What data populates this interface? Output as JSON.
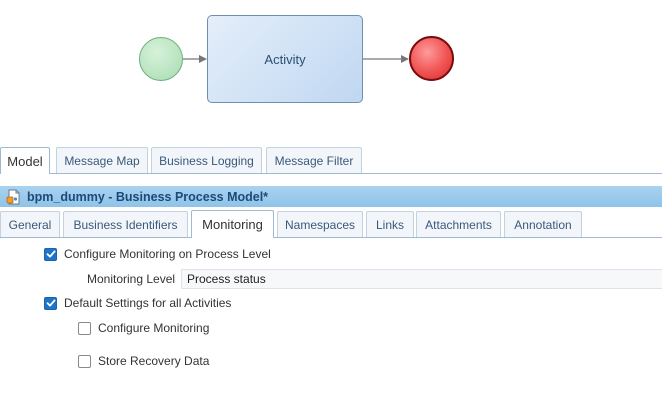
{
  "diagram": {
    "activity_label": "Activity"
  },
  "top_tabs": [
    "Model",
    "Message Map",
    "Business Logging",
    "Message Filter"
  ],
  "top_tabs_active": 0,
  "title_bar": {
    "icon": "process-model-document-icon",
    "title": "bpm_dummy - Business Process Model*",
    "color": "#1c4a78"
  },
  "sub_tabs": [
    "General",
    "Business Identifiers",
    "Monitoring",
    "Namespaces",
    "Links",
    "Attachments",
    "Annotation"
  ],
  "sub_tabs_active": 2,
  "monitoring": {
    "configure_process_level": {
      "label": "Configure Monitoring on Process Level",
      "checked": true
    },
    "monitoring_level": {
      "label": "Monitoring Level",
      "value": "Process status"
    },
    "default_settings_activities": {
      "label": "Default Settings for all Activities",
      "checked": true
    },
    "configure_monitoring": {
      "label": "Configure Monitoring",
      "checked": false
    },
    "store_recovery_data": {
      "label": "Store Recovery Data",
      "checked": false
    }
  },
  "colors": {
    "accent": "#1f73c8",
    "tab_text": "#39597a",
    "title_bar": "#9acbec",
    "start_event": "#b8e3bf",
    "end_event": "#f05353",
    "activity_fill": "#d2e3f6"
  }
}
